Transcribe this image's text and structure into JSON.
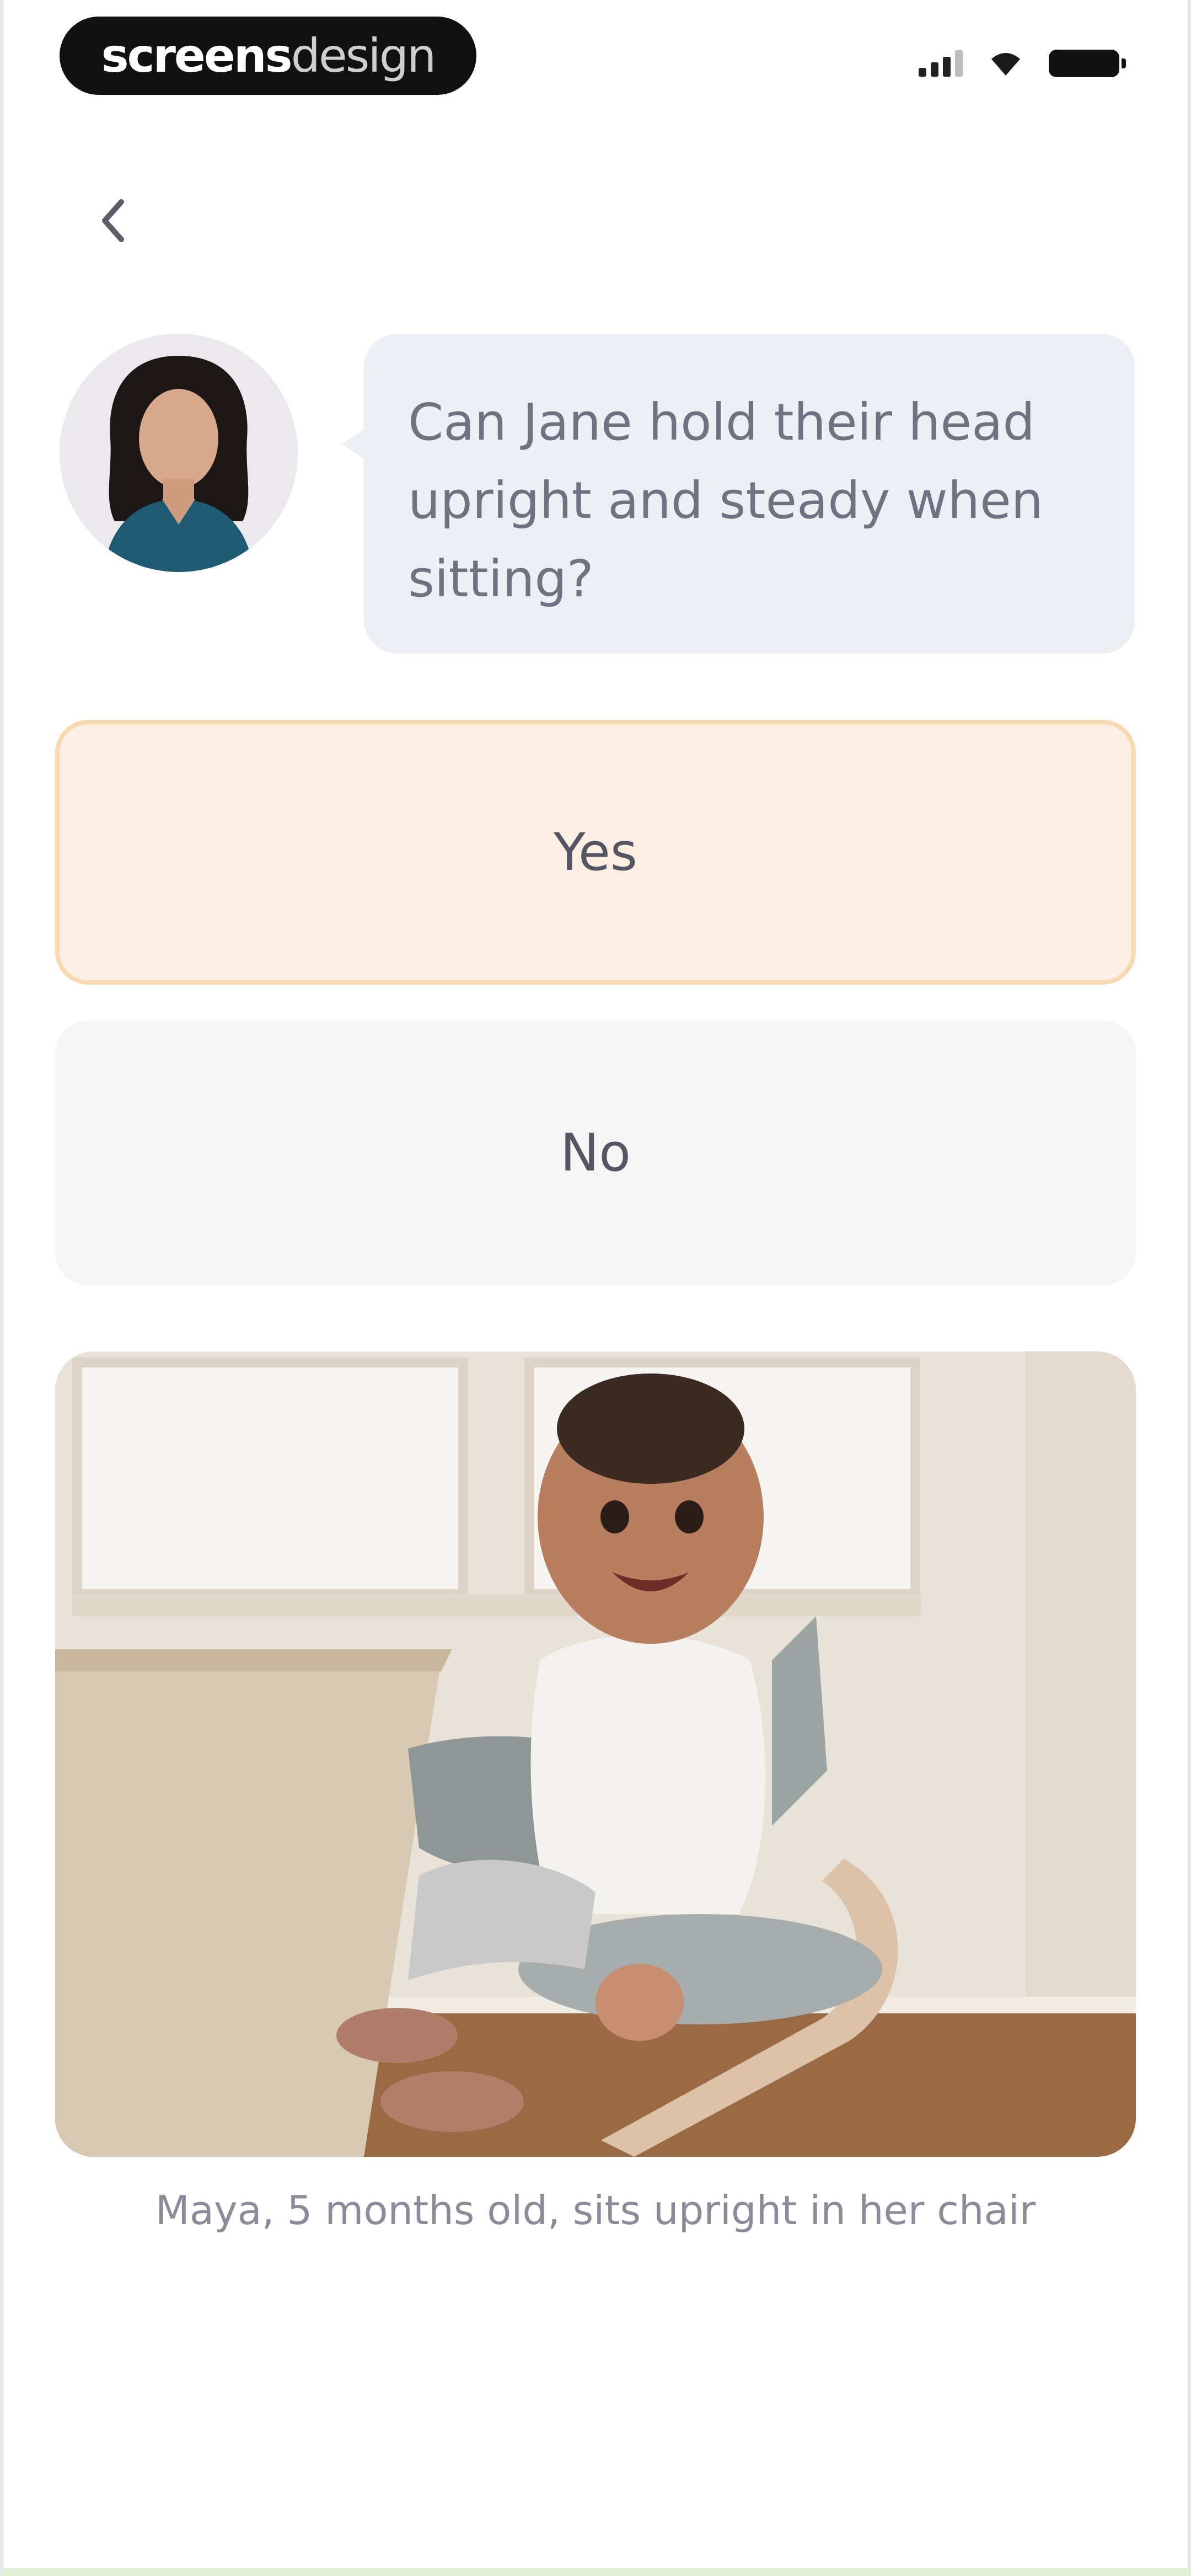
{
  "brand": {
    "bold": "screens",
    "light": "design"
  },
  "question": "Can Jane hold their head upright and steady when sitting?",
  "options": [
    {
      "label": "Yes",
      "selected": true
    },
    {
      "label": "No",
      "selected": false
    }
  ],
  "caption": "Maya, 5 months old, sits upright in her chair",
  "colors": {
    "selected_fill": "#fdefe3",
    "selected_border": "#f8d9b0",
    "bubble_fill": "#eceff3",
    "option_fill": "#f6f6f7"
  },
  "icons": {
    "back": "chevron-left-icon",
    "signal": "cellular-signal-icon",
    "wifi": "wifi-icon",
    "battery": "battery-icon"
  }
}
